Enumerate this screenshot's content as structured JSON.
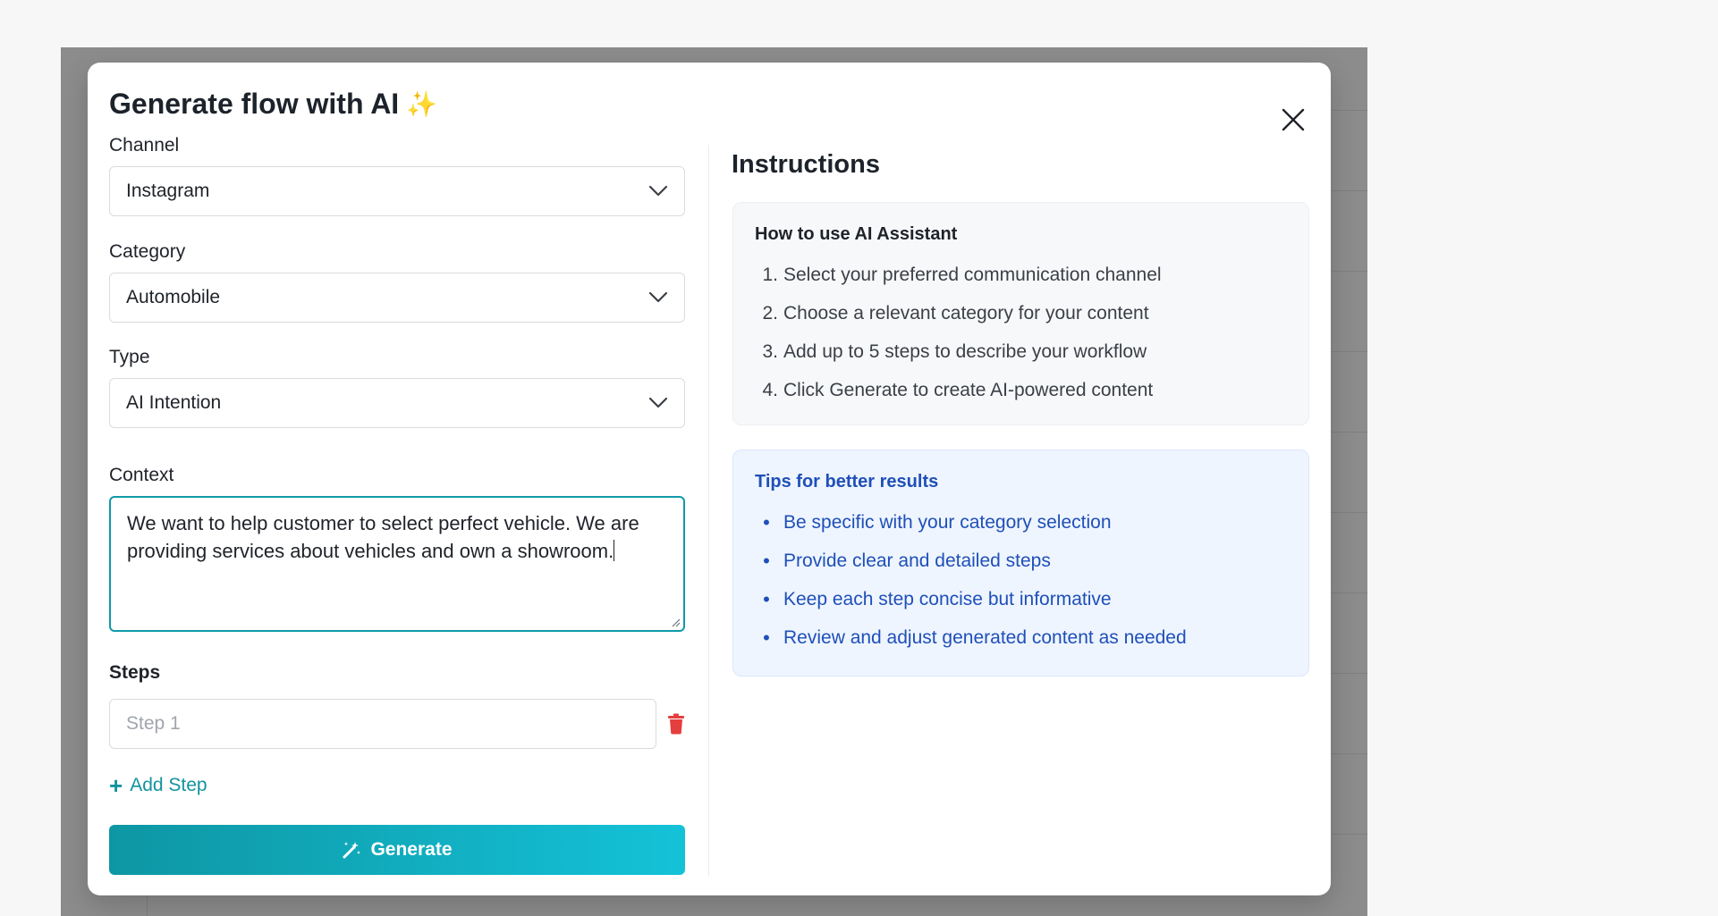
{
  "modal": {
    "title": "Generate flow with AI",
    "title_emoji": "✨"
  },
  "form": {
    "channel": {
      "label": "Channel",
      "value": "Instagram"
    },
    "category": {
      "label": "Category",
      "value": "Automobile"
    },
    "type": {
      "label": "Type",
      "value": "AI Intention"
    },
    "context": {
      "label": "Context",
      "value": "We want to help customer to select perfect vehicle. We are providing services about vehicles and own a showroom."
    },
    "steps": {
      "label": "Steps",
      "items": [
        {
          "placeholder": "Step 1",
          "value": ""
        }
      ]
    },
    "add_step_label": "Add Step",
    "generate_label": "Generate"
  },
  "instructions": {
    "title": "Instructions",
    "howto": {
      "heading": "How to use AI Assistant",
      "items": [
        "Select your preferred communication channel",
        "Choose a relevant category for your content",
        "Add up to 5 steps to describe your workflow",
        "Click Generate to create AI-powered content"
      ]
    },
    "tips": {
      "heading": "Tips for better results",
      "items": [
        "Be specific with your category selection",
        "Provide clear and detailed steps",
        "Keep each step concise but informative",
        "Review and adjust generated content as needed"
      ]
    }
  },
  "colors": {
    "primary": "#0e96a3",
    "primary_light": "#14c2d8",
    "tips_text": "#1f4fb8",
    "tips_bg": "#eef5ff",
    "delete": "#e53e3e"
  },
  "icons": {
    "close": "close-icon",
    "chevron": "chevron-down-icon",
    "trash": "trash-icon",
    "plus": "plus-icon",
    "wand": "magic-wand-icon"
  }
}
